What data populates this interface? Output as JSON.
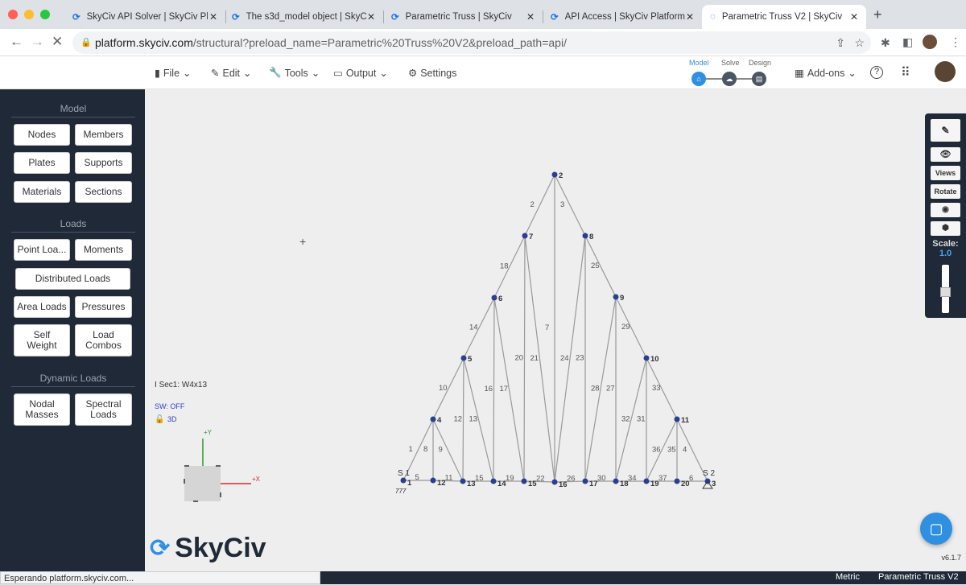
{
  "browser": {
    "tabs": [
      {
        "title": "SkyCiv API Solver | SkyCiv Pla",
        "active": false
      },
      {
        "title": "The s3d_model object | SkyCi",
        "active": false
      },
      {
        "title": "Parametric Truss | SkyCiv",
        "active": false
      },
      {
        "title": "API Access | SkyCiv Platform",
        "active": false
      },
      {
        "title": "Parametric Truss V2 | SkyCiv",
        "active": true
      }
    ],
    "url_host": "platform.skyciv.com",
    "url_path": "/structural?preload_name=Parametric%20Truss%20V2&preload_path=api/",
    "status_text": "Esperando platform.skyciv.com..."
  },
  "menu": {
    "file": "File",
    "edit": "Edit",
    "tools": "Tools",
    "output": "Output",
    "settings": "Settings",
    "addons": "Add-ons"
  },
  "steps": {
    "model": "Model",
    "solve": "Solve",
    "design": "Design"
  },
  "sidebar": {
    "model_header": "Model",
    "nodes": "Nodes",
    "members": "Members",
    "plates": "Plates",
    "supports": "Supports",
    "materials": "Materials",
    "sections": "Sections",
    "loads_header": "Loads",
    "point_loads": "Point Loa...",
    "moments": "Moments",
    "distributed_loads": "Distributed Loads",
    "area_loads": "Area Loads",
    "pressures": "Pressures",
    "self_weight": "Self Weight",
    "load_combos": "Load Combos",
    "dynamic_header": "Dynamic Loads",
    "nodal_masses": "Nodal Masses",
    "spectral_loads": "Spectral Loads"
  },
  "canvas": {
    "section_label": "Sec1: W4x13",
    "sw": "SW: OFF",
    "axis_y": "+Y",
    "axis_x": "+X",
    "logo": "SkyCiv",
    "version": "v6.1.7",
    "support_labels": [
      "S 1",
      "S 2"
    ],
    "nodes": [
      "1",
      "2",
      "3",
      "4",
      "5",
      "6",
      "7",
      "8",
      "9",
      "10",
      "11",
      "12",
      "13",
      "14",
      "15",
      "16",
      "17",
      "18",
      "19",
      "20"
    ],
    "members": [
      [
        "1",
        "1",
        "4"
      ],
      [
        "10",
        "4",
        "5"
      ],
      [
        "14",
        "5",
        "6"
      ],
      [
        "18",
        "6",
        "7"
      ],
      [
        "2",
        "7",
        "2"
      ],
      [
        "3",
        "2",
        "8"
      ],
      [
        "25",
        "8",
        "9"
      ],
      [
        "29",
        "9",
        "10"
      ],
      [
        "33",
        "10",
        "11"
      ],
      [
        "4",
        "11",
        "3"
      ],
      [
        "5",
        "1",
        "12"
      ],
      [
        "11",
        "12",
        "13"
      ],
      [
        "15",
        "13",
        "14"
      ],
      [
        "19",
        "14",
        "15"
      ],
      [
        "22",
        "15",
        "16"
      ],
      [
        "26",
        "16",
        "17"
      ],
      [
        "30",
        "17",
        "18"
      ],
      [
        "34",
        "18",
        "19"
      ],
      [
        "37",
        "19",
        "20"
      ],
      [
        "6",
        "20",
        "3"
      ],
      [
        "8",
        "4",
        "12"
      ],
      [
        "12",
        "5",
        "13"
      ],
      [
        "16",
        "6",
        "14"
      ],
      [
        "20",
        "7",
        "15"
      ],
      [
        "7",
        "2",
        "16"
      ],
      [
        "23",
        "8",
        "17"
      ],
      [
        "27",
        "9",
        "18"
      ],
      [
        "31",
        "10",
        "19"
      ],
      [
        "35",
        "11",
        "20"
      ],
      [
        "9",
        "4",
        "13"
      ],
      [
        "13",
        "5",
        "14"
      ],
      [
        "17",
        "6",
        "15"
      ],
      [
        "21",
        "7",
        "16"
      ],
      [
        "24",
        "8",
        "16"
      ],
      [
        "28",
        "9",
        "17"
      ],
      [
        "32",
        "10",
        "18"
      ],
      [
        "36",
        "11",
        "19"
      ]
    ]
  },
  "right_panel": {
    "views": "Views",
    "rotate": "Rotate",
    "scale_label": "Scale:",
    "scale_value": "1.0"
  },
  "footer": {
    "units": "Metric",
    "model_name": "Parametric Truss V2"
  },
  "colors": {
    "sidebar": "#1f2937",
    "accent": "#2f8fe0",
    "node": "#2b3f8f"
  }
}
